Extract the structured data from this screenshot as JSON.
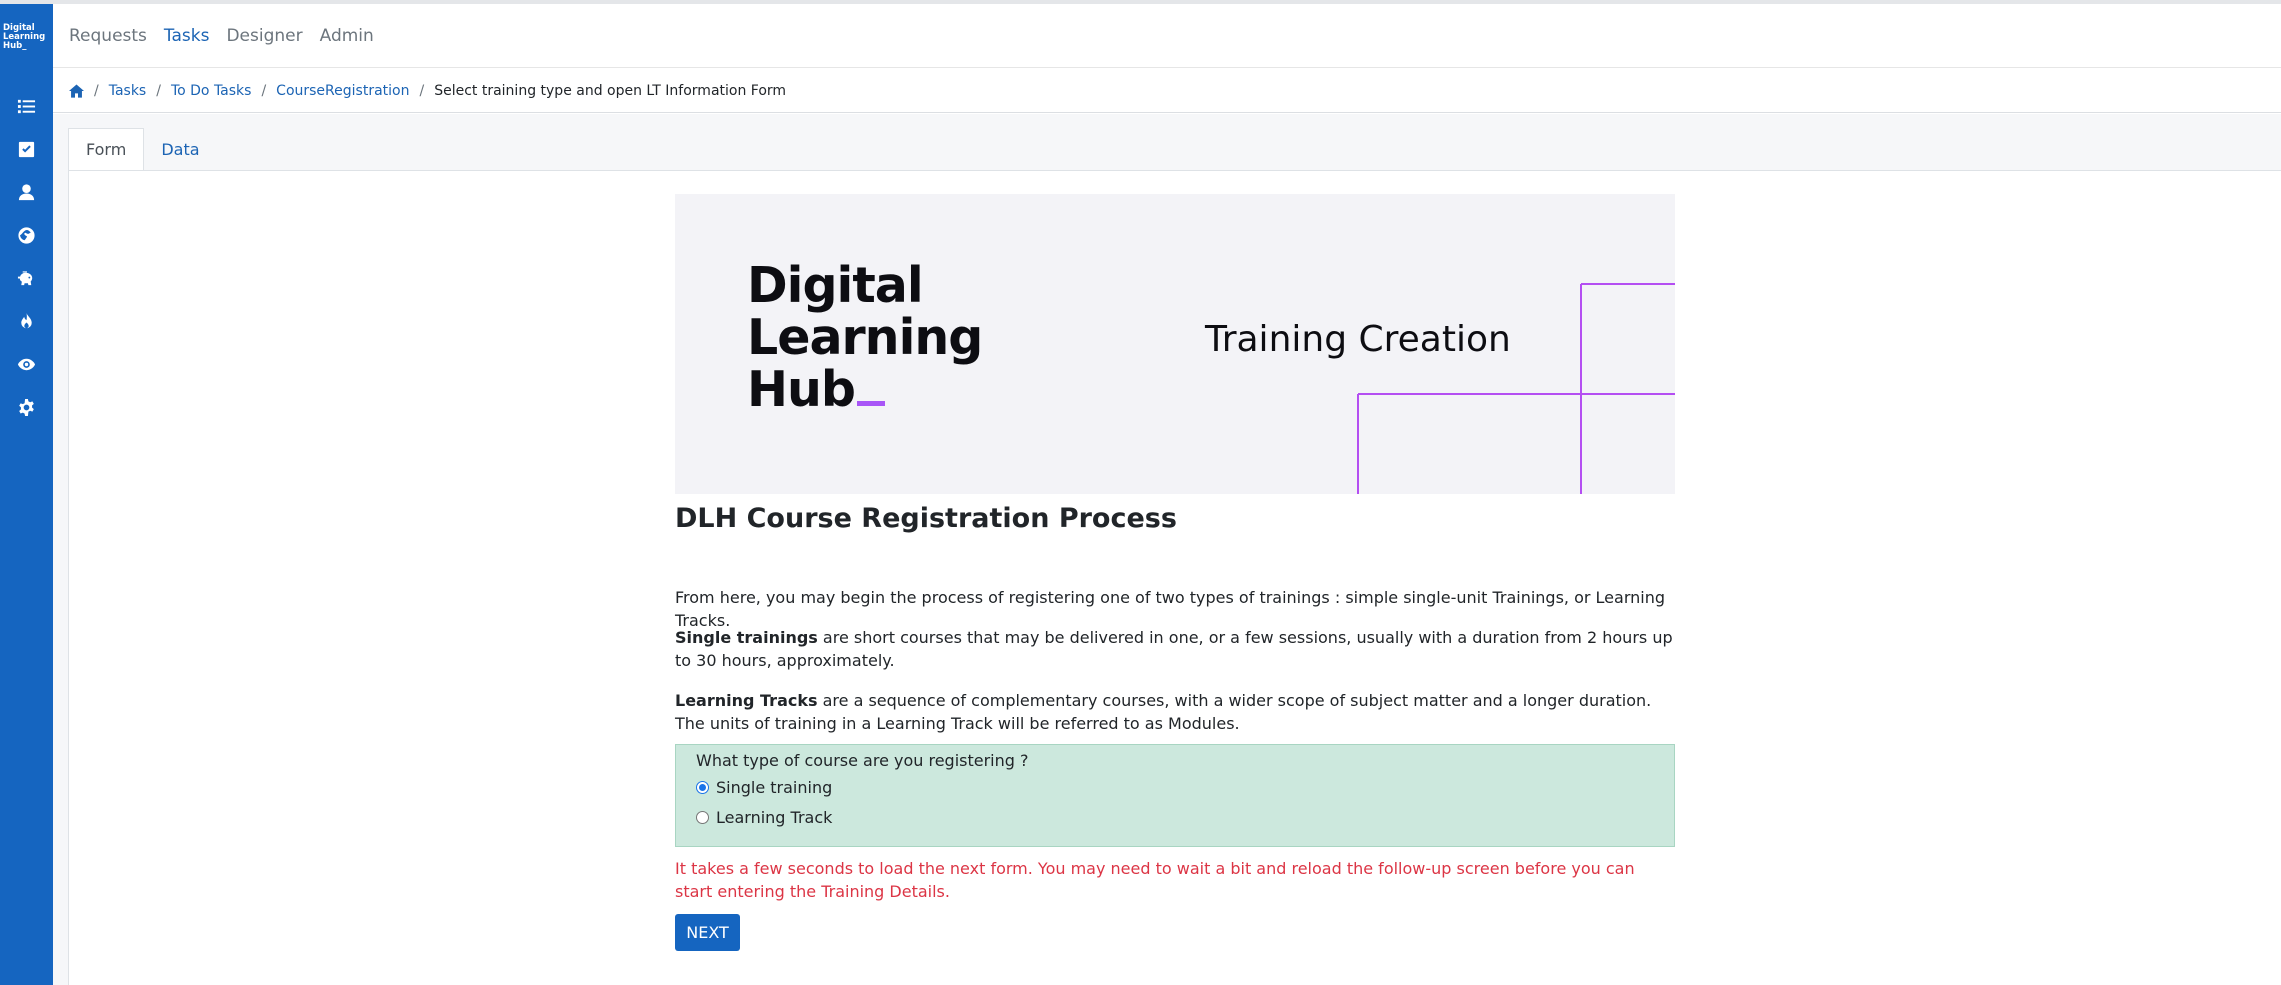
{
  "app": {
    "logo_line1": "Digital",
    "logo_line2": "Learning",
    "logo_line3": "Hub_"
  },
  "sidebar": {
    "icons": [
      "list-icon",
      "check-square-icon",
      "user-icon",
      "globe-icon",
      "piggy-bank-icon",
      "fire-icon",
      "eye-icon",
      "gear-icon"
    ]
  },
  "topnav": {
    "items": [
      {
        "label": "Requests",
        "active": false
      },
      {
        "label": "Tasks",
        "active": true
      },
      {
        "label": "Designer",
        "active": false
      },
      {
        "label": "Admin",
        "active": false
      }
    ]
  },
  "breadcrumb": {
    "home_icon": "home-icon",
    "items": [
      "Tasks",
      "To Do Tasks",
      "CourseRegistration"
    ],
    "current": "Select training type and open LT Information Form"
  },
  "tabs": {
    "form": "Form",
    "data": "Data"
  },
  "banner": {
    "logo_line1": "Digital",
    "logo_line2": "Learning",
    "logo_line3": "Hub",
    "subtitle": "Training Creation",
    "accent_color": "#a855f7"
  },
  "form": {
    "title": "DLH Course Registration Process",
    "intro": "From here, you may begin the process of registering one of two types of trainings : simple single-unit Trainings, or Learning Tracks.",
    "single_bold": "Single trainings",
    "single_text": " are short courses that may be delivered in one, or a few sessions, usually with a duration from 2 hours up to 30 hours, approximately.",
    "tracks_bold": "Learning Tracks",
    "tracks_text": " are a sequence of complementary courses, with a wider scope of subject matter and a longer duration. The units of training in a Learning Track will be referred to as Modules.",
    "question": "What type of course are you registering ?",
    "options": [
      {
        "label": "Single training",
        "checked": true
      },
      {
        "label": "Learning Track",
        "checked": false
      }
    ],
    "warning": "It takes a few seconds to load the next form. You may need to wait a bit and reload the follow-up screen before you can start entering the Training Details.",
    "next_label": "NEXT"
  },
  "colors": {
    "sidebar": "#1565c0",
    "link": "#1c64b4",
    "question_bg": "#cce8dd",
    "warning": "#dc3545"
  }
}
